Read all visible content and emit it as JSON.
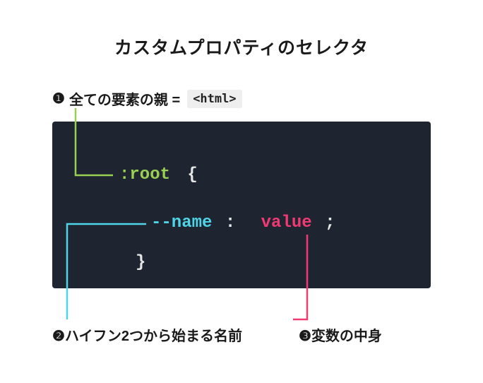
{
  "title": "カスタムプロパティのセレクタ",
  "callouts": {
    "c1": {
      "num": "❶",
      "text": "全ての要素の親 =",
      "tag": "<html>"
    },
    "c2": {
      "num": "❷",
      "text": "ハイフン2つから始まる名前"
    },
    "c3": {
      "num": "❸",
      "text": "変数の中身"
    }
  },
  "code": {
    "selector": ":root",
    "open_brace": "{",
    "var_name": "--name",
    "colon": ":",
    "value": "value",
    "semi": ";",
    "close_brace": "}"
  },
  "colors": {
    "bg_code": "#1f2530",
    "selector": "#99d053",
    "var_name": "#4fd3e6",
    "value": "#ef3a74",
    "line1": "#99d053",
    "line2": "#4fd3e6",
    "line3": "#ef3a74"
  }
}
